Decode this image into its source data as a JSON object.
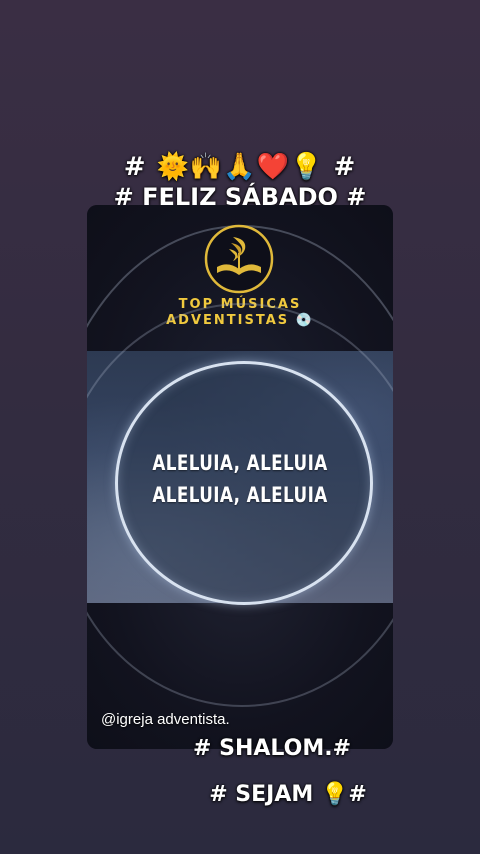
{
  "overlay": {
    "emoji_line": "# 🌞🙌🙏❤️💡 #",
    "headline": "# FELIZ SÁBADO #",
    "shalom": "# SHALOM.#",
    "sejam": "# SEJAM 💡#"
  },
  "card": {
    "brand_line1": "TOP MÚSICAS",
    "brand_line2": "ADVENTISTAS 💿",
    "lyric_line1": "ALELUIA, ALELUIA",
    "lyric_line2": "ALELUIA, ALELUIA",
    "handle": "@igreja adventista."
  },
  "colors": {
    "brand_gold": "#f0c93e",
    "background": "#332c40"
  },
  "icons": {
    "logo": "adventist-logo-icon"
  }
}
